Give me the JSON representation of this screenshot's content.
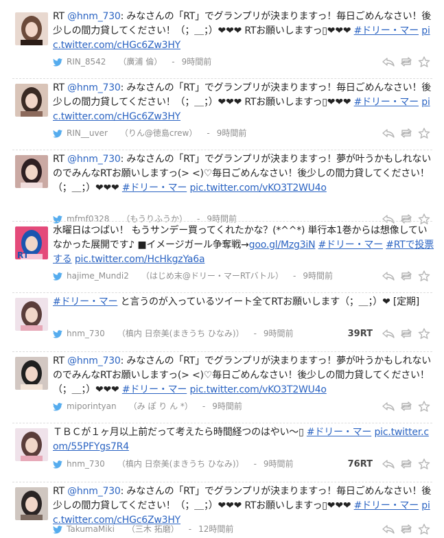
{
  "tweets": [
    {
      "segments": [
        {
          "t": "RT "
        },
        {
          "t": "@hnm_730",
          "link": true,
          "plain": true
        },
        {
          "t": ": みなさんの「RT」でグランプリが決まりますっ！毎日ごめんなさい！後少しの間力貸してください！（；＿；）❤❤❤ RTお願いしますっ▯❤❤❤ "
        },
        {
          "t": "#ドリー・マー",
          "link": true
        },
        {
          "t": " "
        },
        {
          "t": "pic.twitter.com/cHGc6Zw3HY",
          "link": true
        }
      ],
      "username": "RIN_8542",
      "realname": "（廣浦 倫）",
      "sep": "-",
      "time": "9時間前",
      "rt_count": "",
      "avatar_colors": [
        "#e8d8cf",
        "#6b4a3a",
        "#2b1c16"
      ]
    },
    {
      "segments": [
        {
          "t": "RT "
        },
        {
          "t": "@hnm_730",
          "link": true,
          "plain": true
        },
        {
          "t": ": みなさんの「RT」でグランプリが決まりますっ！毎日ごめんなさい！後少しの間力貸してください！（；＿；）❤❤❤ RTお願いしますっ▯❤❤❤ "
        },
        {
          "t": "#ドリー・マー",
          "link": true
        },
        {
          "t": " "
        },
        {
          "t": "pic.twitter.com/cHGc6Zw3HY",
          "link": true
        }
      ],
      "username": "RIN__uver",
      "realname": "（りん@徳島crew）",
      "sep": "-",
      "time": "9時間前",
      "rt_count": "",
      "avatar_colors": [
        "#d9c4b8",
        "#3a2a24",
        "#8c6a5c"
      ]
    },
    {
      "segments": [
        {
          "t": "RT "
        },
        {
          "t": "@hnm_730",
          "link": true,
          "plain": true
        },
        {
          "t": ": みなさんの「RT」でグランプリが決まりますっ！夢が叶うかもしれないのでみんなRTお願いしますっ(> <)♡毎日ごめんなさい！後少しの間力貸してください！（；＿；）❤❤❤ "
        },
        {
          "t": "#ドリー・マー",
          "link": true
        },
        {
          "t": " "
        },
        {
          "t": "pic.twitter.com/vKO3T2WU4o",
          "link": true
        }
      ],
      "username": "mfmf0328",
      "realname": "（もうりふうか）",
      "sep": "-",
      "time": "9時間前",
      "rt_count": "",
      "avatar_colors": [
        "#caa9a3",
        "#2e1f22",
        "#f0dcdc"
      ]
    },
    {
      "segments": [
        {
          "t": "水曜日はつばい！ もうサンデー買ってくれたかな？(*^^*) 単行本1巻からは想像していなかった展開です♪ ■イメージガール争奪戦→"
        },
        {
          "t": "goo.gl/Mzg3iN",
          "link": true
        },
        {
          "t": " "
        },
        {
          "t": "#ドリー・マー",
          "link": true
        },
        {
          "t": " "
        },
        {
          "t": "#RTで投票する",
          "link": true
        },
        {
          "t": " "
        },
        {
          "t": "pic.twitter.com/HcHkgzYa6a",
          "link": true
        }
      ],
      "username": "hajime_Mundi2",
      "realname": "（はじめ末@ドリー・マーRTバトル）",
      "sep": "-",
      "time": "9時間前",
      "rt_count": "",
      "avatar_colors": [
        "#e44a7a",
        "#1a55b0",
        "#f6c6d6"
      ],
      "avatar_text": "RT"
    },
    {
      "segments": [
        {
          "t": "#ドリー・マー",
          "link": true
        },
        {
          "t": " と言うのが入っているツイート全てRTお願いします（；＿；）❤ [定期]"
        }
      ],
      "username": "hnm_730",
      "realname": "（槙内 日奈美(まきうち ひなみ)）",
      "sep": "-",
      "time": "9時間前",
      "rt_count": "39RT",
      "avatar_colors": [
        "#efe2ea",
        "#5a3d3a",
        "#e7a9b8"
      ]
    },
    {
      "segments": [
        {
          "t": "RT "
        },
        {
          "t": "@hnm_730",
          "link": true,
          "plain": true
        },
        {
          "t": ": みなさんの「RT」でグランプリが決まりますっ！夢が叶うかもしれないのでみんなRTお願いしますっ(> <)♡毎日ごめんなさい！後少しの間力貸してください！（；＿；）❤❤❤ "
        },
        {
          "t": "#ドリー・マー",
          "link": true
        },
        {
          "t": " "
        },
        {
          "t": "pic.twitter.com/vKO3T2WU4o",
          "link": true
        }
      ],
      "username": "miporintyan",
      "realname": "（み ぽ り ん *）",
      "sep": "-",
      "time": "9時間前",
      "rt_count": "",
      "avatar_colors": [
        "#d2c7c2",
        "#1f1f1f",
        "#f3e4d8"
      ]
    },
    {
      "segments": [
        {
          "t": "ＴＢＣが１ヶ月以上前だって考えたら時間経つのはやい〜▯ "
        },
        {
          "t": "#ドリー・マー",
          "link": true
        },
        {
          "t": " "
        },
        {
          "t": "pic.twitter.com/55PFYgs7R4",
          "link": true
        }
      ],
      "username": "hnm_730",
      "realname": "（槙内 日奈美(まきうち ひなみ)）",
      "sep": "-",
      "time": "9時間前",
      "rt_count": "76RT",
      "avatar_colors": [
        "#efe2ea",
        "#5a3d3a",
        "#e7a9b8"
      ]
    },
    {
      "segments": [
        {
          "t": "RT "
        },
        {
          "t": "@hnm_730",
          "link": true,
          "plain": true
        },
        {
          "t": ": みなさんの「RT」でグランプリが決まりますっ！毎日ごめんなさい！後少しの間力貸してください！（；＿；）❤❤❤ RTお願いしますっ▯❤❤❤ "
        },
        {
          "t": "#ドリー・マー",
          "link": true
        },
        {
          "t": " "
        },
        {
          "t": "pic.twitter.com/cHGc6Zw3HY",
          "link": true
        }
      ],
      "username": "TakumaMiki",
      "realname": "（三木 拓磨）",
      "sep": "-",
      "time": "12時間前",
      "rt_count": "",
      "avatar_colors": [
        "#cfc6c0",
        "#2a2424",
        "#7c6a60"
      ]
    }
  ],
  "icons": {
    "bird": "twitter-bird-icon",
    "reply": "reply-icon",
    "retweet": "retweet-icon",
    "favorite": "star-icon"
  },
  "colors": {
    "link": "#2a63c2",
    "text": "#222222",
    "meta": "#8e8e8e",
    "bird": "#55acee",
    "action": "#b5b5b5"
  }
}
